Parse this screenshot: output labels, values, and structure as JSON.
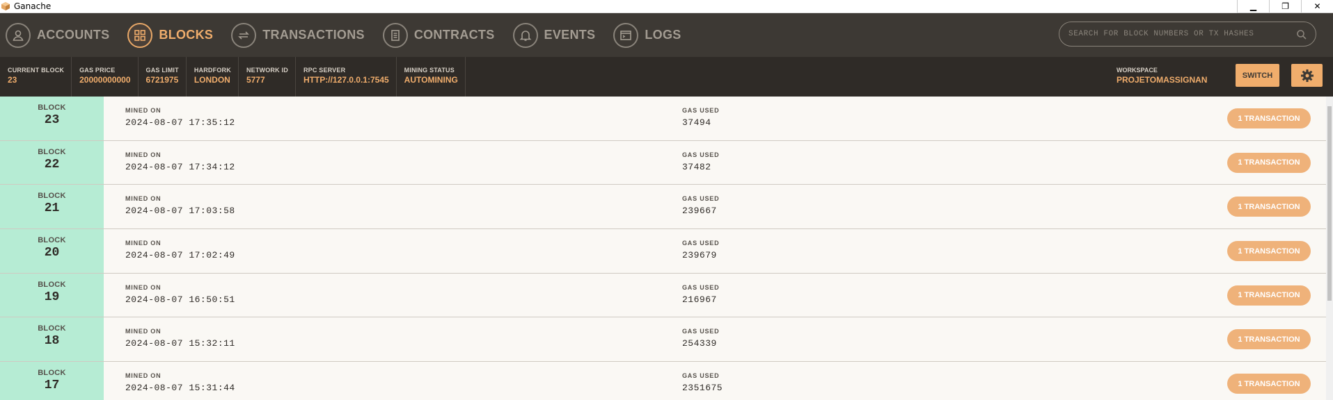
{
  "window": {
    "title": "Ganache",
    "minimize": "▁",
    "restore": "❐",
    "close": "✕"
  },
  "nav": {
    "items": [
      {
        "label": "ACCOUNTS",
        "icon": "person-icon",
        "active": false
      },
      {
        "label": "BLOCKS",
        "icon": "grid-icon",
        "active": true
      },
      {
        "label": "TRANSACTIONS",
        "icon": "swap-arrows-icon",
        "active": false
      },
      {
        "label": "CONTRACTS",
        "icon": "document-icon",
        "active": false
      },
      {
        "label": "EVENTS",
        "icon": "bell-icon",
        "active": false
      },
      {
        "label": "LOGS",
        "icon": "terminal-icon",
        "active": false
      }
    ],
    "search_placeholder": "SEARCH FOR BLOCK NUMBERS OR TX HASHES"
  },
  "status": {
    "current_block": {
      "label": "CURRENT BLOCK",
      "value": "23"
    },
    "gas_price": {
      "label": "GAS PRICE",
      "value": "20000000000"
    },
    "gas_limit": {
      "label": "GAS LIMIT",
      "value": "6721975"
    },
    "hardfork": {
      "label": "HARDFORK",
      "value": "LONDON"
    },
    "network_id": {
      "label": "NETWORK ID",
      "value": "5777"
    },
    "rpc_server": {
      "label": "RPC SERVER",
      "value": "HTTP://127.0.0.1:7545"
    },
    "mining_status": {
      "label": "MINING STATUS",
      "value": "AUTOMINING"
    },
    "workspace": {
      "label": "WORKSPACE",
      "value": "PROJETOMASSIGNAN"
    },
    "switch_label": "SWITCH"
  },
  "blocks": {
    "block_label": "BLOCK",
    "mined_label": "MINED ON",
    "gas_label": "GAS USED",
    "rows": [
      {
        "number": "23",
        "mined_on": "2024-08-07 17:35:12",
        "gas_used": "37494",
        "tx": "1 TRANSACTION"
      },
      {
        "number": "22",
        "mined_on": "2024-08-07 17:34:12",
        "gas_used": "37482",
        "tx": "1 TRANSACTION"
      },
      {
        "number": "21",
        "mined_on": "2024-08-07 17:03:58",
        "gas_used": "239667",
        "tx": "1 TRANSACTION"
      },
      {
        "number": "20",
        "mined_on": "2024-08-07 17:02:49",
        "gas_used": "239679",
        "tx": "1 TRANSACTION"
      },
      {
        "number": "19",
        "mined_on": "2024-08-07 16:50:51",
        "gas_used": "216967",
        "tx": "1 TRANSACTION"
      },
      {
        "number": "18",
        "mined_on": "2024-08-07 15:32:11",
        "gas_used": "254339",
        "tx": "1 TRANSACTION"
      },
      {
        "number": "17",
        "mined_on": "2024-08-07 15:31:44",
        "gas_used": "2351675",
        "tx": "1 TRANSACTION"
      }
    ]
  },
  "colors": {
    "accent": "#f0ad6c",
    "block_bg": "#b6ecd4",
    "nav_bg": "#3d3934",
    "status_bg": "#2f2b27"
  }
}
